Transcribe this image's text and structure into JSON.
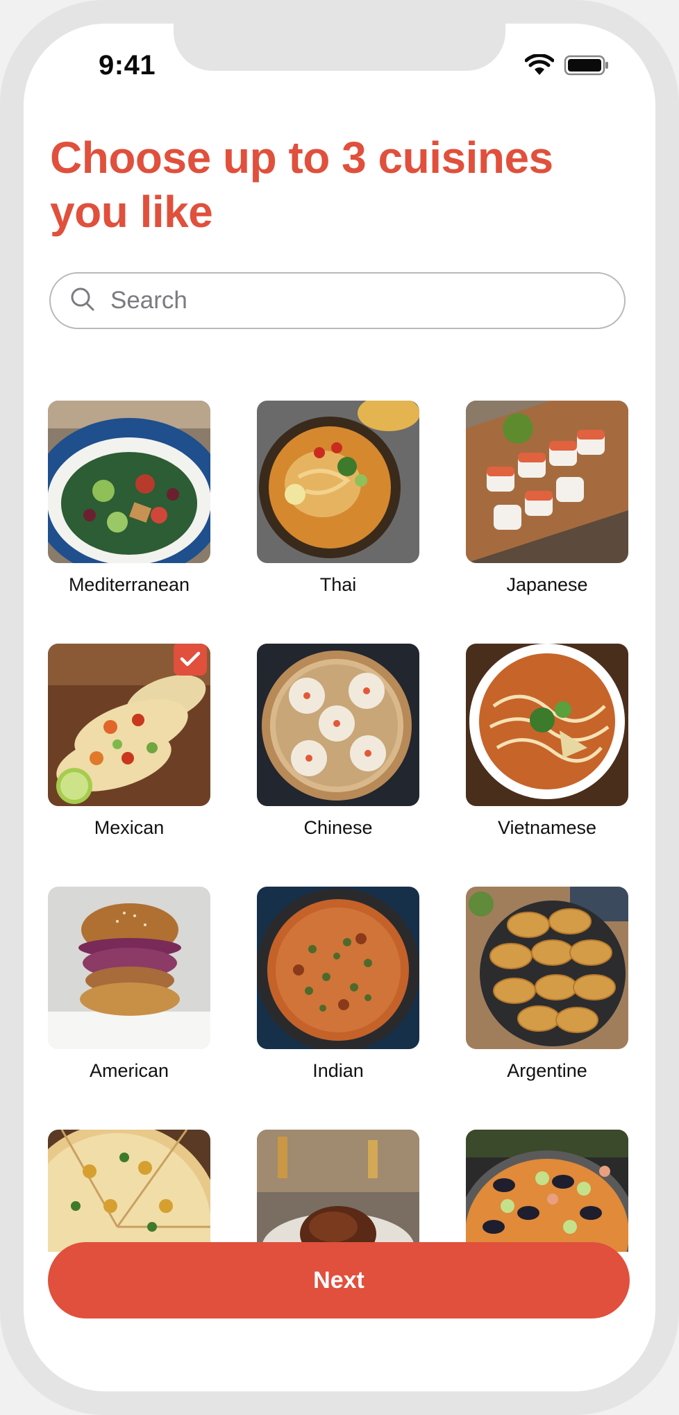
{
  "status_bar": {
    "time": "9:41"
  },
  "title": "Choose up to 3 cuisines you like",
  "search": {
    "placeholder": "Search",
    "value": ""
  },
  "cuisines": [
    {
      "label": "Mediterranean",
      "selected": false
    },
    {
      "label": "Thai",
      "selected": false
    },
    {
      "label": "Japanese",
      "selected": false
    },
    {
      "label": "Mexican",
      "selected": true
    },
    {
      "label": "Chinese",
      "selected": false
    },
    {
      "label": "Vietnamese",
      "selected": false
    },
    {
      "label": "American",
      "selected": false
    },
    {
      "label": "Indian",
      "selected": false
    },
    {
      "label": "Argentine",
      "selected": false
    },
    {
      "label": "",
      "selected": false
    },
    {
      "label": "",
      "selected": false
    },
    {
      "label": "",
      "selected": false
    }
  ],
  "next_button": {
    "label": "Next"
  },
  "colors": {
    "accent": "#e0503c",
    "text": "#111111"
  }
}
